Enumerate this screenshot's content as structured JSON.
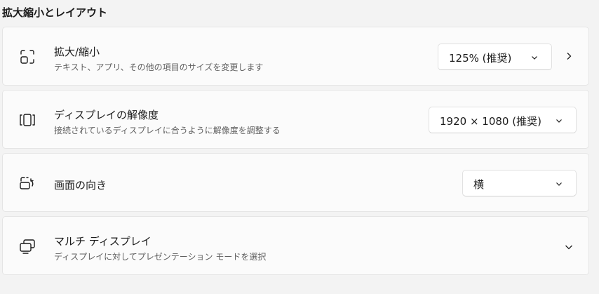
{
  "section_title": "拡大縮小とレイアウト",
  "cards": {
    "scale": {
      "title": "拡大/縮小",
      "description": "テキスト、アプリ、その他の項目のサイズを変更します",
      "value": "125% (推奨)",
      "icon": "scale-icon"
    },
    "resolution": {
      "title": "ディスプレイの解像度",
      "description": "接続されているディスプレイに合うように解像度を調整する",
      "value": "1920 × 1080 (推奨)",
      "icon": "resolution-icon"
    },
    "orientation": {
      "title": "画面の向き",
      "value": "横",
      "icon": "orientation-icon"
    },
    "multi_display": {
      "title": "マルチ ディスプレイ",
      "description": "ディスプレイに対してプレゼンテーション モードを選択",
      "icon": "multi-display-icon"
    }
  }
}
